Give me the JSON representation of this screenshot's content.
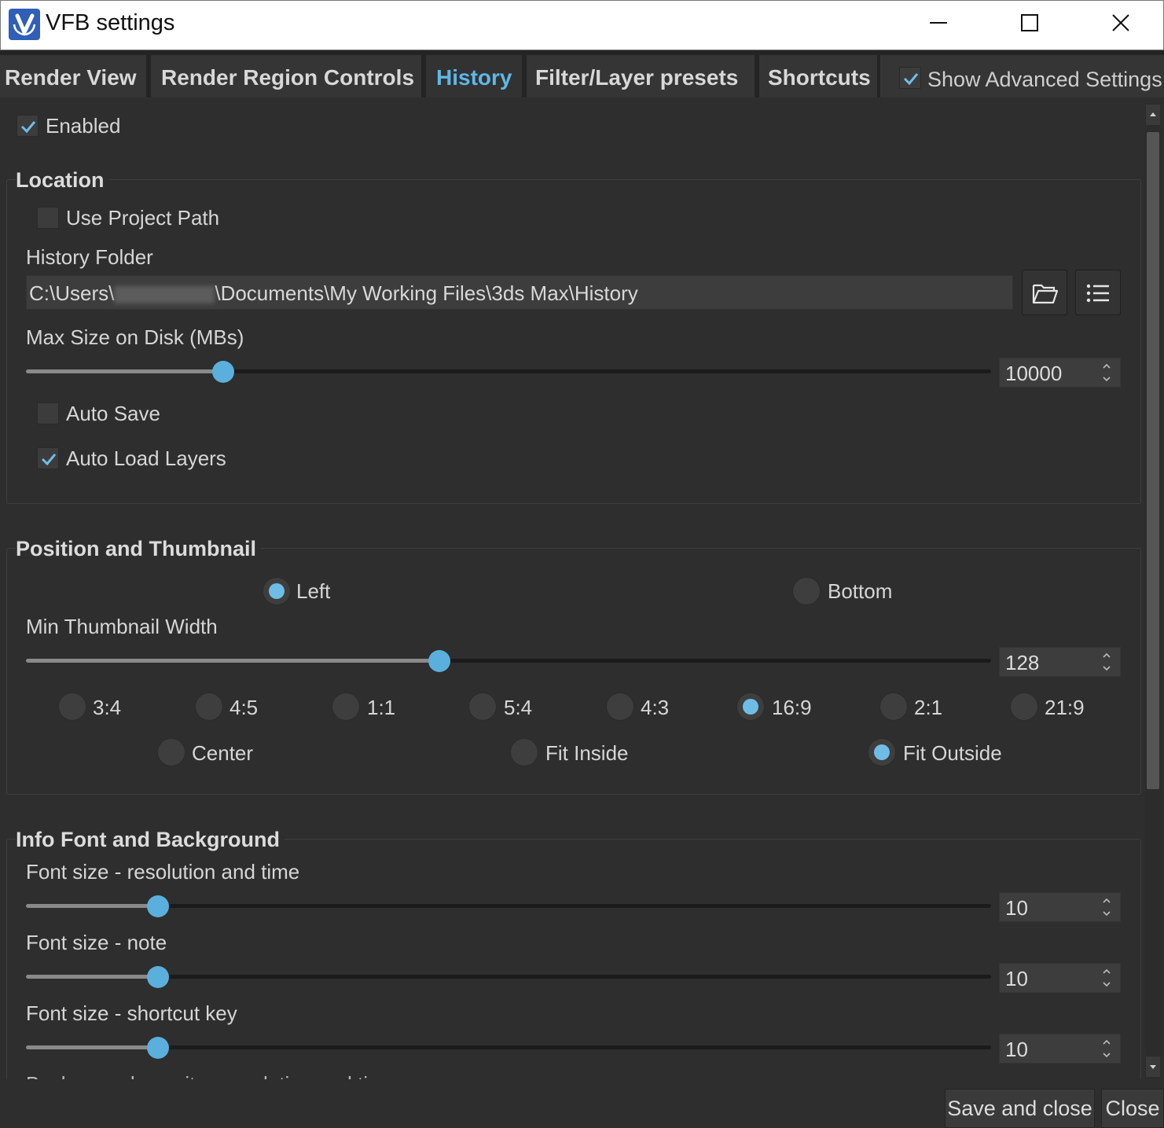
{
  "window": {
    "title": "VFB settings"
  },
  "tabs": [
    {
      "label": "Render View",
      "active": false
    },
    {
      "label": "Render Region Controls",
      "active": false
    },
    {
      "label": "History",
      "active": true
    },
    {
      "label": "Filter/Layer presets",
      "active": false
    },
    {
      "label": "Shortcuts",
      "active": false
    }
  ],
  "show_advanced": {
    "label": "Show Advanced Settings",
    "checked": true
  },
  "enabled": {
    "label": "Enabled",
    "checked": true
  },
  "location": {
    "title": "Location",
    "use_project_path": {
      "label": "Use Project Path",
      "checked": false
    },
    "history_folder_label": "History Folder",
    "path_prefix": "C:\\Users\\",
    "path_suffix": "\\Documents\\My Working Files\\3ds Max\\History",
    "max_size_label": "Max Size on Disk (MBs)",
    "max_size_value": "10000",
    "max_size_slider_fraction": 0.204,
    "auto_save": {
      "label": "Auto Save",
      "checked": false
    },
    "auto_load_layers": {
      "label": "Auto Load Layers",
      "checked": true
    }
  },
  "position": {
    "title": "Position and Thumbnail",
    "left_label": "Left",
    "bottom_label": "Bottom",
    "selected_position": "Left",
    "min_thumb_label": "Min Thumbnail Width",
    "min_thumb_value": "128",
    "min_thumb_slider_fraction": 0.428,
    "ratios": [
      "3:4",
      "4:5",
      "1:1",
      "5:4",
      "4:3",
      "16:9",
      "2:1",
      "21:9"
    ],
    "selected_ratio": "16:9",
    "fit_modes": [
      "Center",
      "Fit Inside",
      "Fit Outside"
    ],
    "selected_fit": "Fit Outside"
  },
  "info": {
    "title": "Info Font and Background",
    "res_time_label": "Font size - resolution and time",
    "res_time_value": "10",
    "note_label": "Font size - note",
    "note_value": "10",
    "shortcut_label": "Font size - shortcut key",
    "shortcut_value": "10",
    "font_slider_fraction": 0.137,
    "cut_label": "Background opacity - resolution and time"
  },
  "buttons": {
    "save_close": "Save and close",
    "close": "Close"
  },
  "colors": {
    "accent": "#5eb8e6",
    "background": "#2e2e2e",
    "title_bar": "#ffffff",
    "app_icon": "#2f5fb7"
  },
  "icons": [
    "vray-logo-icon",
    "minimize-icon",
    "maximize-icon",
    "close-icon",
    "check-icon",
    "folder-open-icon",
    "list-icon",
    "spin-arrows-icon",
    "scroll-up-icon",
    "scroll-down-icon"
  ]
}
